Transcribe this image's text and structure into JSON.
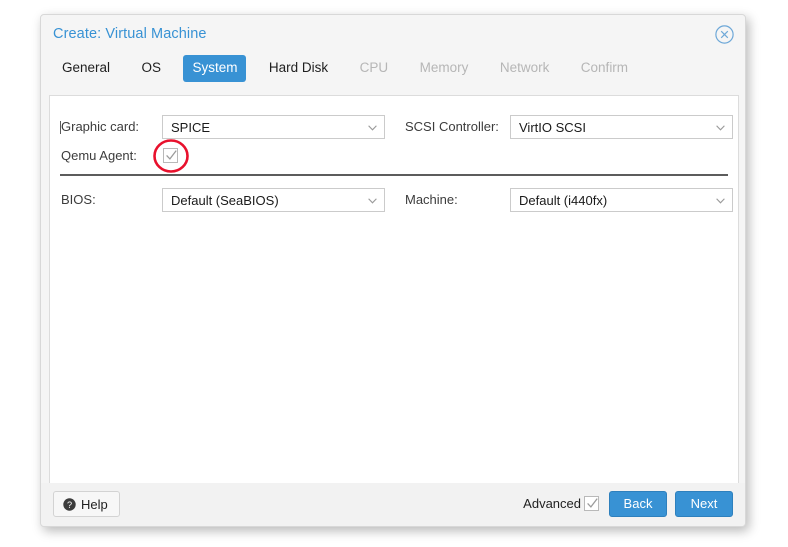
{
  "window": {
    "title": "Create: Virtual Machine",
    "close_icon": "close-circle-icon"
  },
  "tabs": [
    {
      "label": "General",
      "state": "enabled"
    },
    {
      "label": "OS",
      "state": "enabled"
    },
    {
      "label": "System",
      "state": "active"
    },
    {
      "label": "Hard Disk",
      "state": "enabled"
    },
    {
      "label": "CPU",
      "state": "disabled"
    },
    {
      "label": "Memory",
      "state": "disabled"
    },
    {
      "label": "Network",
      "state": "disabled"
    },
    {
      "label": "Confirm",
      "state": "disabled"
    }
  ],
  "form": {
    "graphic_card": {
      "label": "Graphic card:",
      "value": "SPICE"
    },
    "scsi_controller": {
      "label": "SCSI Controller:",
      "value": "VirtIO SCSI"
    },
    "qemu_agent": {
      "label": "Qemu Agent:",
      "checked": true
    },
    "bios": {
      "label": "BIOS:",
      "value": "Default (SeaBIOS)"
    },
    "machine": {
      "label": "Machine:",
      "value": "Default (i440fx)"
    }
  },
  "annotation": {
    "shape": "ellipse",
    "color": "#e8112d",
    "target": "qemu-agent-checkbox"
  },
  "footer": {
    "help_label": "Help",
    "help_icon": "question-mark-icon",
    "advanced_label": "Advanced",
    "advanced_checked": true,
    "back_label": "Back",
    "next_label": "Next"
  },
  "colors": {
    "accent": "#3892d4",
    "title": "#3892d4",
    "annotation": "#e8112d",
    "disabled_text": "#b6b6b6",
    "dialog_bg": "#f5f5f5",
    "content_bg": "#ffffff"
  }
}
